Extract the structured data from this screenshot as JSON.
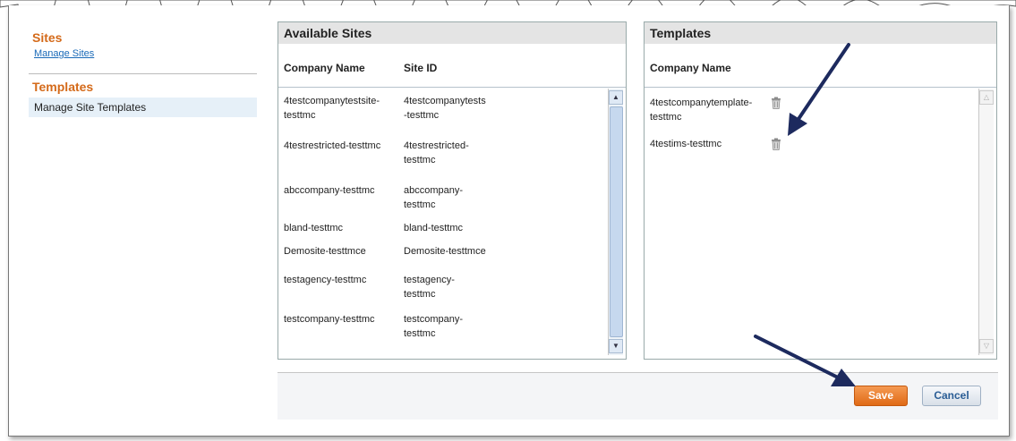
{
  "sidebar": {
    "sites_heading": "Sites",
    "manage_sites_link": "Manage Sites",
    "templates_heading": "Templates",
    "manage_templates_item": "Manage Site Templates"
  },
  "available_sites": {
    "title": "Available Sites",
    "col_company": "Company Name",
    "col_site_id": "Site ID",
    "rows": [
      {
        "company": "4testcompanytestsite-\ntesttmc",
        "site_id": "4testcompanytests\n-testtmc"
      },
      {
        "company": "4testrestricted-testtmc",
        "site_id": "4testrestricted-\ntesttmc"
      },
      {
        "company": "abccompany-testtmc",
        "site_id": "abccompany-\ntesttmc"
      },
      {
        "company": "bland-testtmc",
        "site_id": "bland-testtmc"
      },
      {
        "company": "Demosite-testtmce",
        "site_id": "Demosite-testtmce"
      },
      {
        "company": "testagency-testtmc",
        "site_id": "testagency-\ntesttmc"
      },
      {
        "company": "testcompany-testtmc",
        "site_id": "testcompany-\ntesttmc"
      }
    ]
  },
  "templates": {
    "title": "Templates",
    "col_company": "Company Name",
    "rows": [
      {
        "company": "4testcompanytemplate-\ntesttmc",
        "icon": "trash-icon"
      },
      {
        "company": "4testims-testtmc",
        "icon": "trash-icon"
      }
    ]
  },
  "footer": {
    "save_label": "Save",
    "cancel_label": "Cancel"
  },
  "colors": {
    "accent_orange": "#e06a16",
    "link_blue": "#1a6ab8",
    "annotation_arrow": "#1d2a5e"
  }
}
